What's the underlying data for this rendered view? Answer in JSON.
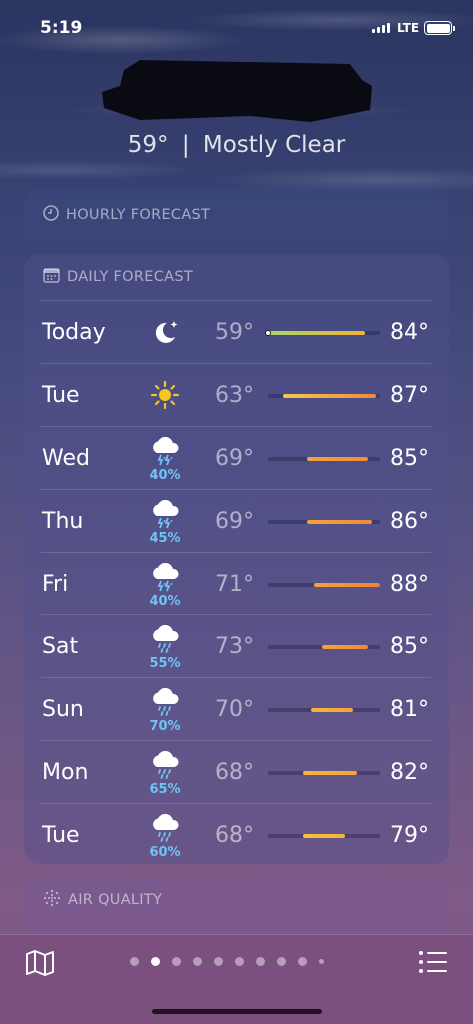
{
  "status_bar": {
    "time": "5:19",
    "network": "LTE"
  },
  "current": {
    "temperature": "59°",
    "separator": "|",
    "condition": "Mostly Clear"
  },
  "hourly_card": {
    "title": "HOURLY FORECAST",
    "icon": "clock-icon"
  },
  "daily_card": {
    "title": "DAILY FORECAST",
    "icon": "calendar-icon",
    "range_min": 59,
    "range_max": 88,
    "days": [
      {
        "day": "Today",
        "icon": "moon-stars-icon",
        "precip": "",
        "low": "59°",
        "high": "84°",
        "low_val": 59,
        "high_val": 84,
        "current_val": 59,
        "bar_colors": [
          "#a6d66a",
          "#f3b23a"
        ]
      },
      {
        "day": "Tue",
        "icon": "sun-icon",
        "precip": "",
        "low": "63°",
        "high": "87°",
        "low_val": 63,
        "high_val": 87,
        "bar_colors": [
          "#f2c94c",
          "#f08a3c"
        ]
      },
      {
        "day": "Wed",
        "icon": "thunderstorm-icon",
        "precip": "40%",
        "low": "69°",
        "high": "85°",
        "low_val": 69,
        "high_val": 85,
        "bar_colors": [
          "#f3a33a",
          "#f08a3c"
        ]
      },
      {
        "day": "Thu",
        "icon": "thunderstorm-icon",
        "precip": "45%",
        "low": "69°",
        "high": "86°",
        "low_val": 69,
        "high_val": 86,
        "bar_colors": [
          "#f3a33a",
          "#f08a3c"
        ]
      },
      {
        "day": "Fri",
        "icon": "thunderstorm-icon",
        "precip": "40%",
        "low": "71°",
        "high": "88°",
        "low_val": 71,
        "high_val": 88,
        "bar_colors": [
          "#f3a33a",
          "#ef7f3a"
        ]
      },
      {
        "day": "Sat",
        "icon": "rain-icon",
        "precip": "55%",
        "low": "73°",
        "high": "85°",
        "low_val": 73,
        "high_val": 85,
        "bar_colors": [
          "#f3a33a",
          "#f08a3c"
        ]
      },
      {
        "day": "Sun",
        "icon": "rain-icon",
        "precip": "70%",
        "low": "70°",
        "high": "81°",
        "low_val": 70,
        "high_val": 81,
        "bar_colors": [
          "#f5b53a",
          "#f3a33a"
        ]
      },
      {
        "day": "Mon",
        "icon": "rain-icon",
        "precip": "65%",
        "low": "68°",
        "high": "82°",
        "low_val": 68,
        "high_val": 82,
        "bar_colors": [
          "#f5b53a",
          "#f3a33a"
        ]
      },
      {
        "day": "Tue",
        "icon": "rain-icon",
        "precip": "60%",
        "low": "68°",
        "high": "79°",
        "low_val": 68,
        "high_val": 79,
        "bar_colors": [
          "#f5c23a",
          "#f5b53a"
        ]
      }
    ]
  },
  "air_card": {
    "title": "AIR QUALITY",
    "icon": "air-quality-icon"
  },
  "bottom_bar": {
    "page_count": 10,
    "active_page": 1
  }
}
